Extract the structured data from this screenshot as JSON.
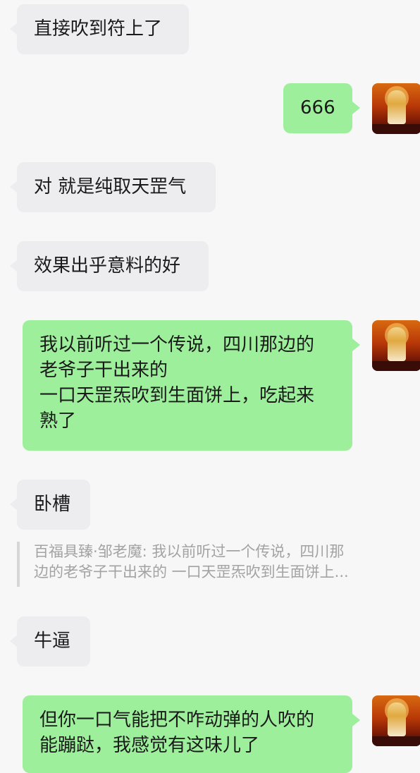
{
  "messages": [
    {
      "side": "left",
      "text": "直接吹到符上了"
    },
    {
      "side": "right",
      "text": "666"
    },
    {
      "side": "left",
      "text": "对 就是纯取天罡气"
    },
    {
      "side": "left",
      "text": "效果出乎意料的好"
    },
    {
      "side": "right",
      "lines": [
        "我以前听过一个传说，四川那边的",
        "老爷子干出来的",
        "一口天罡炁吹到生面饼上，吃起来",
        "熟了"
      ]
    },
    {
      "side": "left",
      "text": "卧槽"
    },
    {
      "side": "left",
      "text": "牛逼"
    },
    {
      "side": "right",
      "lines": [
        "但你一口气能把不咋动弹的人吹的",
        "能蹦跶，我感觉有这味儿了"
      ]
    }
  ],
  "quote": {
    "lines": [
      "百福具臻·邹老魔: 我以前听过一个传说，四川那",
      "边的老爷子干出来的 一口天罡炁吹到生面饼上..."
    ]
  }
}
